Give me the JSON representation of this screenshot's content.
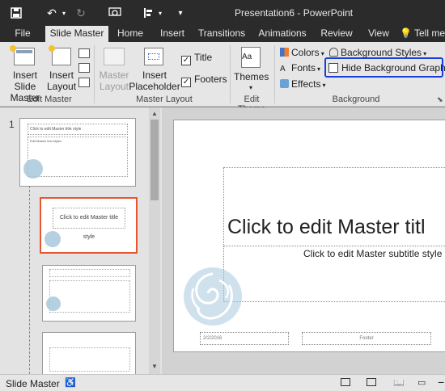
{
  "window": {
    "title": "Presentation6 - PowerPoint"
  },
  "tabs": [
    {
      "label": "File"
    },
    {
      "label": "Slide Master"
    },
    {
      "label": "Home"
    },
    {
      "label": "Insert"
    },
    {
      "label": "Transitions"
    },
    {
      "label": "Animations"
    },
    {
      "label": "Review"
    },
    {
      "label": "View"
    },
    {
      "label": "Tell me"
    }
  ],
  "ribbon": {
    "edit_master": {
      "group_label": "Edit Master",
      "insert_slide_master": "Insert Slide Master",
      "insert_layout": "Insert Layout"
    },
    "master_layout": {
      "group_label": "Master Layout",
      "master_layout": "Master Layout",
      "insert_placeholder": "Insert Placeholder",
      "title": "Title",
      "footers": "Footers",
      "title_checked": true,
      "footers_checked": true
    },
    "edit_theme": {
      "group_label": "Edit Theme",
      "themes": "Themes"
    },
    "background": {
      "group_label": "Background",
      "colors": "Colors",
      "fonts": "Fonts",
      "effects": "Effects",
      "background_styles": "Background Styles",
      "hide_background_graphics": "Hide Background Graphics"
    }
  },
  "slides_pane": {
    "slide_number": "1",
    "master_title": "Click to edit Master title style",
    "master_text": "Edit Master text styles",
    "layout_title": "Click to edit Master title style"
  },
  "slide": {
    "title": "Click to edit Master titl",
    "subtitle": "Click to edit Master subtitle style",
    "date": "2/2/2016",
    "footer": "Footer"
  },
  "status": {
    "view_label": "Slide Master"
  },
  "colors": {
    "accent": "#b7472a",
    "highlight": "#1a3fd8",
    "swirl": "#a8c8dc"
  }
}
